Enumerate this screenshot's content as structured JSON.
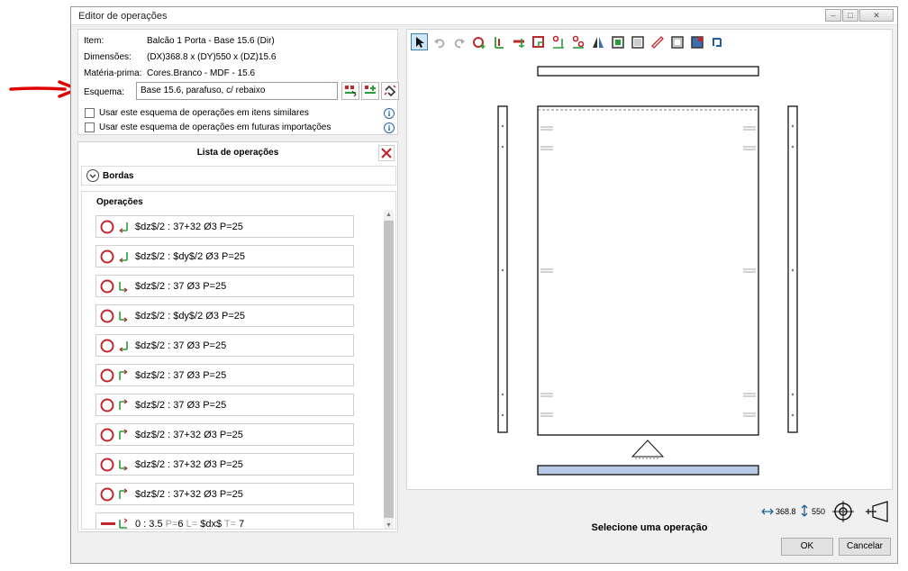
{
  "window": {
    "title": "Editor de operações"
  },
  "info": {
    "item_label": "Item:",
    "item_value": "Balcão 1 Porta - Base 15.6 (Dir)",
    "dim_label": "Dimensões:",
    "dim_value": "(DX)368.8 x (DY)550 x (DZ)15.6",
    "mat_label": "Matéria-prima:",
    "mat_value": "Cores.Branco - MDF - 15.6",
    "esquema_label": "Esquema:",
    "esquema_value": "Base 15.6, parafuso, c/ rebaixo",
    "check1": "Usar este esquema de operações em itens similares",
    "check2": "Usar este esquema de operações em futuras importações"
  },
  "ops_panel": {
    "title": "Lista de operações",
    "bordas_label": "Bordas",
    "operacoes_label": "Operações",
    "operations": [
      {
        "text": "$dz$/2 : 37+32 Ø3 P=25"
      },
      {
        "text": "$dz$/2 : $dy$/2 Ø3 P=25"
      },
      {
        "text": "$dz$/2 : 37 Ø3 P=25"
      },
      {
        "text": "$dz$/2 : $dy$/2 Ø3 P=25"
      },
      {
        "text": "$dz$/2 : 37 Ø3 P=25"
      },
      {
        "text": "$dz$/2 : 37 Ø3 P=25"
      },
      {
        "text": "$dz$/2 : 37 Ø3 P=25"
      },
      {
        "text": "$dz$/2 : 37+32 Ø3 P=25"
      },
      {
        "text": "$dz$/2 : 37+32 Ø3 P=25"
      },
      {
        "text": "$dz$/2 : 37+32 Ø3 P=25"
      }
    ],
    "last_op": {
      "a": "0 : 3.5",
      "p_label": "P=",
      "p_value": "6",
      "l_label": "L=",
      "l_value": "$dx$",
      "t_label": "T=",
      "t_value": "7"
    }
  },
  "dims": {
    "width": "368.8",
    "height": "550"
  },
  "status": "Selecione uma operação",
  "buttons": {
    "ok": "OK",
    "cancel": "Cancelar"
  },
  "colors": {
    "accent_red": "#c0272d",
    "accent_green": "#2a9d3a",
    "selected_part": "#b8c9e6"
  }
}
